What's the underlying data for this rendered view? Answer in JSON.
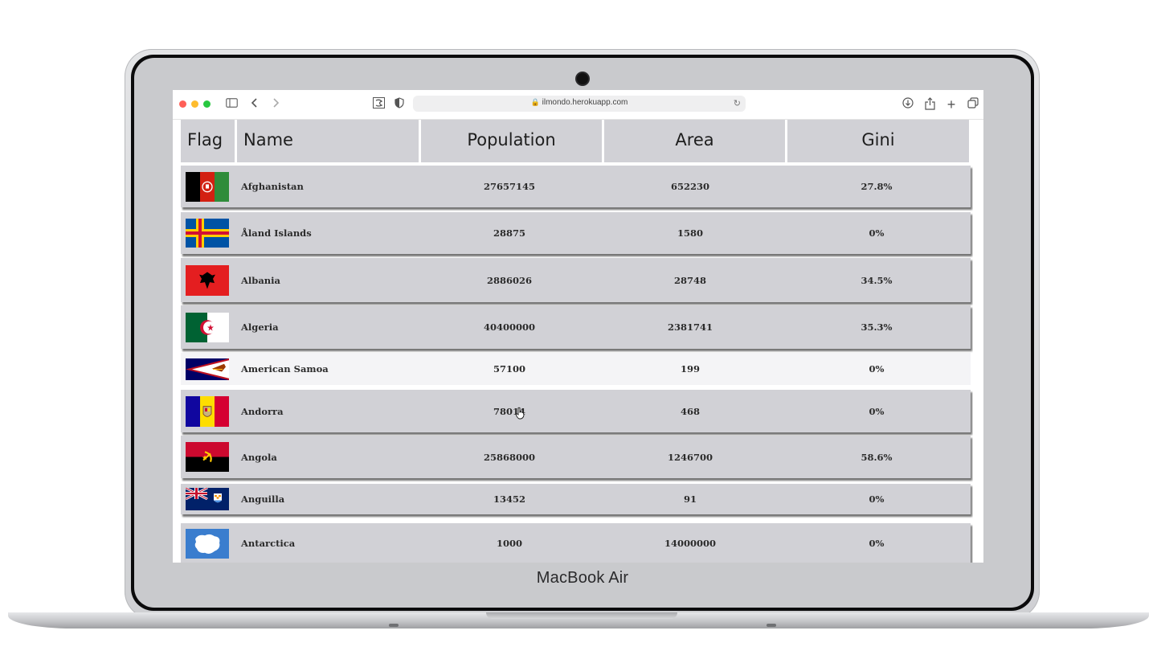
{
  "device": {
    "label": "MacBook Air"
  },
  "browser": {
    "url": "ilmondo.herokuapp.com",
    "traffic_lights": [
      "#ff5f57",
      "#febc2e",
      "#28c840"
    ],
    "icons": [
      "sidebar-icon",
      "back-icon",
      "forward-icon",
      "reader-icon",
      "privacy-shield-icon",
      "reload-icon",
      "download-icon",
      "share-icon",
      "new-tab-icon",
      "tab-overview-icon"
    ]
  },
  "table": {
    "headers": {
      "flag": "Flag",
      "name": "Name",
      "population": "Population",
      "area": "Area",
      "gini": "Gini"
    },
    "rows": [
      {
        "name": "Afghanistan",
        "population": "27657145",
        "area": "652230",
        "gini": "27.8%",
        "flag": "afghanistan"
      },
      {
        "name": "Åland Islands",
        "population": "28875",
        "area": "1580",
        "gini": "0%",
        "flag": "aland"
      },
      {
        "name": "Albania",
        "population": "2886026",
        "area": "28748",
        "gini": "34.5%",
        "flag": "albania"
      },
      {
        "name": "Algeria",
        "population": "40400000",
        "area": "2381741",
        "gini": "35.3%",
        "flag": "algeria"
      },
      {
        "name": "American Samoa",
        "population": "57100",
        "area": "199",
        "gini": "0%",
        "flag": "american-samoa",
        "hovered": true
      },
      {
        "name": "Andorra",
        "population": "78014",
        "area": "468",
        "gini": "0%",
        "flag": "andorra"
      },
      {
        "name": "Angola",
        "population": "25868000",
        "area": "1246700",
        "gini": "58.6%",
        "flag": "angola"
      },
      {
        "name": "Anguilla",
        "population": "13452",
        "area": "91",
        "gini": "0%",
        "flag": "anguilla"
      },
      {
        "name": "Antarctica",
        "population": "1000",
        "area": "14000000",
        "gini": "0%",
        "flag": "antarctica"
      }
    ]
  }
}
